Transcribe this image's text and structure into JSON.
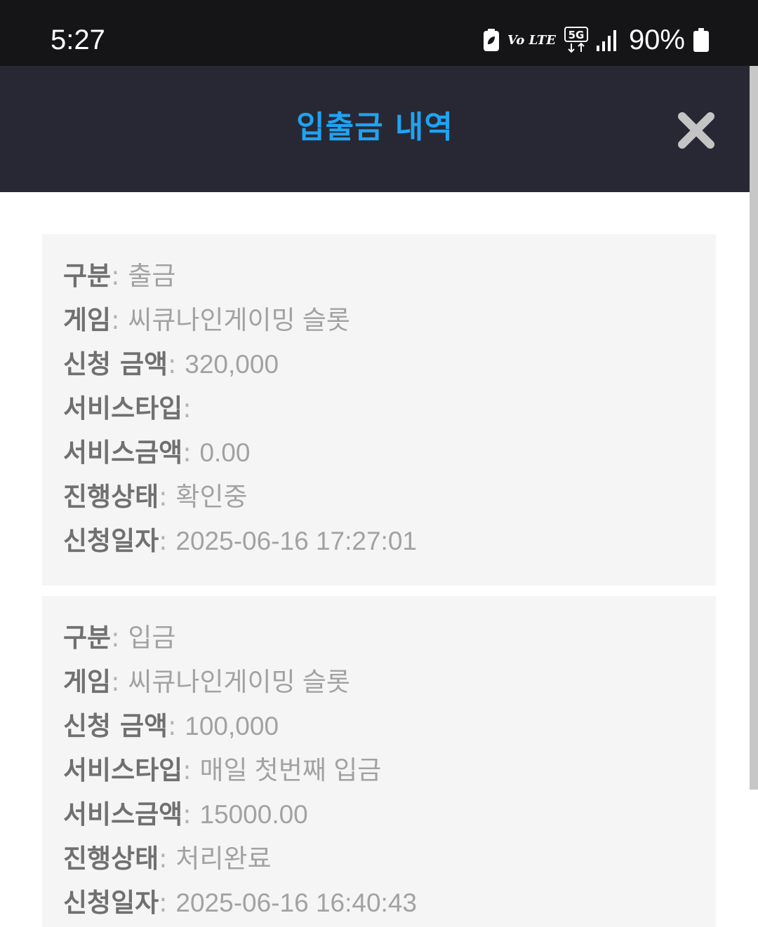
{
  "status_bar": {
    "time": "5:27",
    "network_label": "Vo LTE",
    "network_5g": "5G",
    "battery": "90%"
  },
  "header": {
    "title": "입출금 내역",
    "close_icon": "close-x-icon"
  },
  "colors": {
    "title": "#1fa3f2",
    "header_bg": "#282834",
    "card_bg": "#f5f5f5"
  },
  "records": [
    {
      "fields": [
        {
          "label": "구분",
          "value": "출금"
        },
        {
          "label": "게임",
          "value": "씨큐나인게이밍 슬롯"
        },
        {
          "label": "신청 금액",
          "value": "320,000"
        },
        {
          "label": "서비스타입",
          "value": ""
        },
        {
          "label": "서비스금액",
          "value": "0.00"
        },
        {
          "label": "진행상태",
          "value": "확인중"
        },
        {
          "label": "신청일자",
          "value": "2025-06-16 17:27:01"
        }
      ]
    },
    {
      "fields": [
        {
          "label": "구분",
          "value": "입금"
        },
        {
          "label": "게임",
          "value": "씨큐나인게이밍 슬롯"
        },
        {
          "label": "신청 금액",
          "value": "100,000"
        },
        {
          "label": "서비스타입",
          "value": "매일 첫번째 입금"
        },
        {
          "label": "서비스금액",
          "value": "15000.00"
        },
        {
          "label": "진행상태",
          "value": "처리완료"
        },
        {
          "label": "신청일자",
          "value": "2025-06-16 16:40:43"
        }
      ]
    }
  ]
}
